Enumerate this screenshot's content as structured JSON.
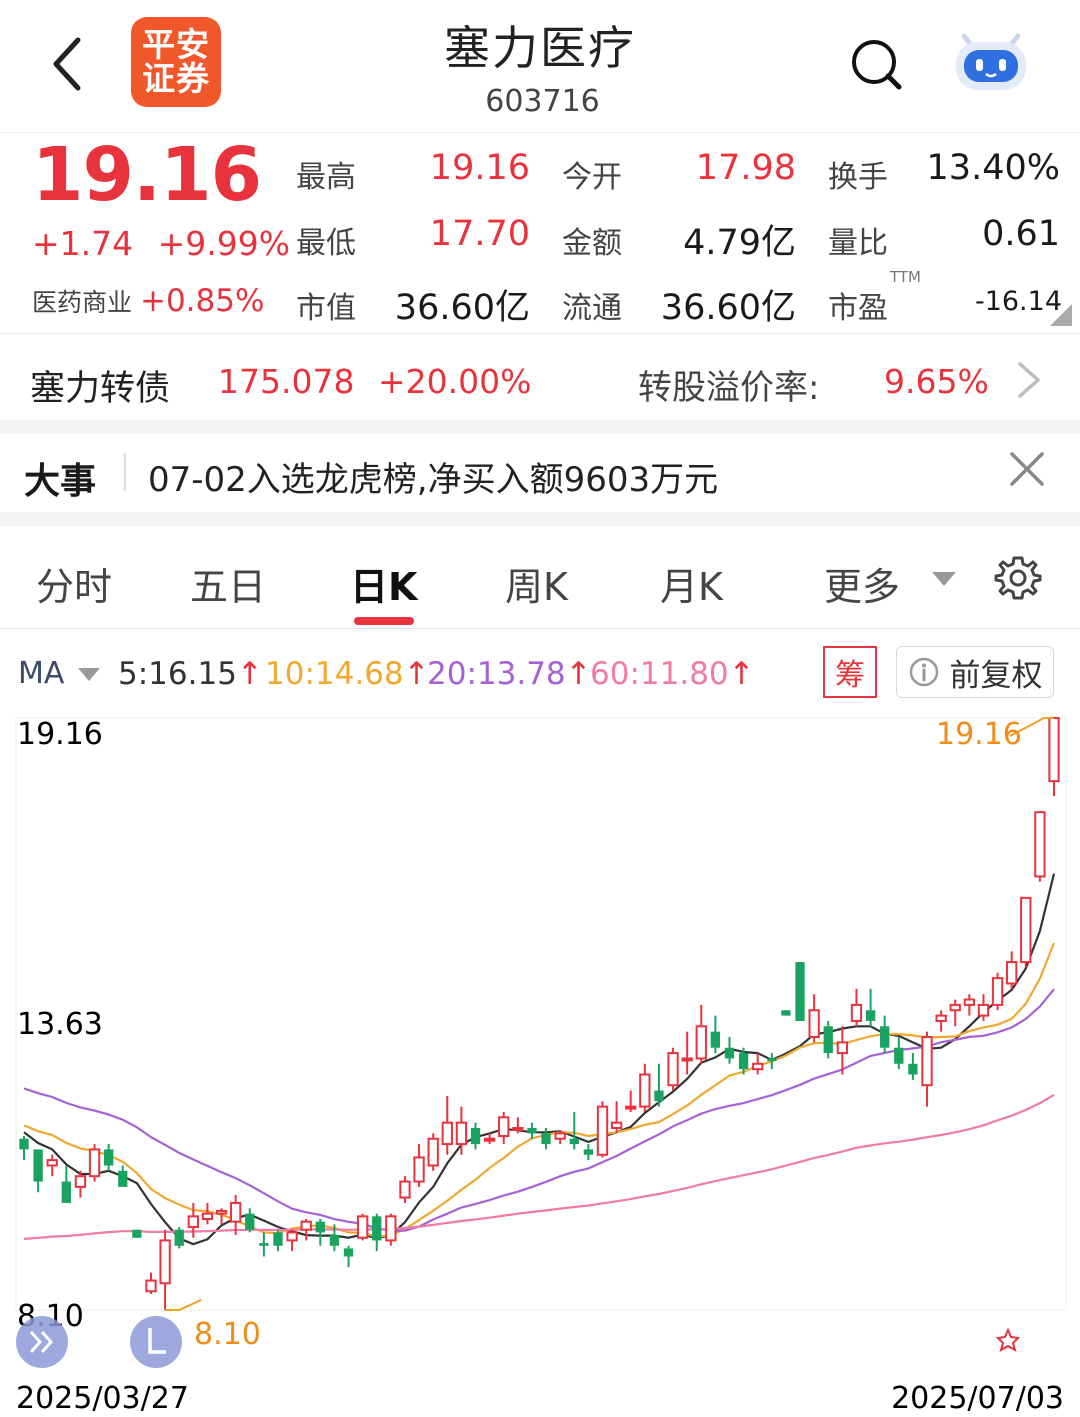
{
  "header": {
    "broker_logo": "平安证券",
    "logo_line1": "平安",
    "logo_line2": "证券",
    "stock_name": "塞力医疗",
    "stock_code": "603716",
    "back_icon": "chevron-left-icon",
    "search_icon": "search-icon",
    "assistant_icon": "robot-icon"
  },
  "quote": {
    "price": "19.16",
    "change": "+1.74",
    "change_pct": "+9.99%",
    "sector_name": "医药商业",
    "sector_pct": "+0.85%",
    "fields": [
      {
        "label": "最高",
        "value": "19.16",
        "color": "#e8333c"
      },
      {
        "label": "今开",
        "value": "17.98",
        "color": "#e8333c"
      },
      {
        "label": "换手",
        "value": "13.40%",
        "color": "#1a1a1a"
      },
      {
        "label": "最低",
        "value": "17.70",
        "color": "#e8333c"
      },
      {
        "label": "金额",
        "value": "4.79亿",
        "color": "#1a1a1a"
      },
      {
        "label": "量比",
        "value": "0.61",
        "color": "#1a1a1a"
      },
      {
        "label": "市值",
        "value": "36.60亿",
        "color": "#1a1a1a"
      },
      {
        "label": "流通",
        "value": "36.60亿",
        "color": "#1a1a1a"
      },
      {
        "label": "市盈",
        "value": "-16.14",
        "color": "#1a1a1a"
      }
    ],
    "pe_superscript": "TTM"
  },
  "bond": {
    "name": "塞力转债",
    "price": "175.078",
    "change_pct": "+20.00%",
    "premium_label": "转股溢价率:",
    "premium_value": "9.65%"
  },
  "event": {
    "tag": "大事",
    "text": "07-02入选龙虎榜,净买入额9603万元"
  },
  "tabs": [
    {
      "label": "分时",
      "active": false
    },
    {
      "label": "五日",
      "active": false
    },
    {
      "label": "日K",
      "active": true
    },
    {
      "label": "周K",
      "active": false
    },
    {
      "label": "月K",
      "active": false
    },
    {
      "label": "更多",
      "active": false
    }
  ],
  "ma": {
    "label": "MA",
    "items": [
      {
        "text": "5:16.15",
        "color": "#333333"
      },
      {
        "text": "10:14.68",
        "color": "#f0a830"
      },
      {
        "text": "20:13.78",
        "color": "#a561d6"
      },
      {
        "text": "60:11.80",
        "color": "#f07aa8"
      }
    ],
    "arrow": "↑",
    "chip_button": "筹",
    "adjust_button": "前复权",
    "info_icon": "info-icon"
  },
  "chart_data": {
    "type": "candlestick",
    "y_max_label": "19.16",
    "y_mid_label": "13.63",
    "y_min_label": "8.10",
    "ylim": [
      8.1,
      19.16
    ],
    "high_marker": "19.16",
    "low_marker": "8.10",
    "start_date": "2025/03/27",
    "end_date": "2025/07/03",
    "colors": {
      "up": "#e8333c",
      "down": "#1aa260",
      "ma5": "#333333",
      "ma10": "#f0a830",
      "ma20": "#a561d6",
      "ma60": "#f07aa8"
    },
    "candles": [
      [
        11.3,
        11.35,
        10.9,
        11.1
      ],
      [
        11.1,
        11.1,
        10.3,
        10.5
      ],
      [
        10.8,
        11.0,
        10.6,
        10.9
      ],
      [
        10.5,
        10.8,
        10.2,
        10.1
      ],
      [
        10.4,
        10.7,
        10.2,
        10.6
      ],
      [
        10.6,
        11.2,
        10.5,
        11.1
      ],
      [
        11.1,
        11.2,
        10.7,
        10.8
      ],
      [
        10.7,
        10.8,
        10.5,
        10.4
      ],
      [
        9.6,
        9.6,
        9.45,
        9.45
      ],
      [
        8.45,
        8.8,
        8.4,
        8.65
      ],
      [
        8.6,
        9.6,
        8.1,
        9.4
      ],
      [
        9.6,
        9.65,
        9.25,
        9.3
      ],
      [
        9.65,
        10.1,
        9.45,
        9.85
      ],
      [
        9.8,
        10.1,
        9.7,
        9.9
      ],
      [
        9.9,
        10.0,
        9.7,
        9.95
      ],
      [
        9.75,
        10.25,
        9.5,
        10.1
      ],
      [
        9.9,
        10.0,
        9.55,
        9.6
      ],
      [
        9.35,
        9.55,
        9.1,
        9.3
      ],
      [
        9.55,
        9.6,
        9.2,
        9.3
      ],
      [
        9.4,
        9.6,
        9.2,
        9.55
      ],
      [
        9.6,
        9.8,
        9.4,
        9.75
      ],
      [
        9.75,
        9.8,
        9.3,
        9.55
      ],
      [
        9.5,
        9.7,
        9.2,
        9.3
      ],
      [
        9.25,
        9.3,
        8.9,
        9.1
      ],
      [
        9.45,
        9.9,
        9.4,
        9.85
      ],
      [
        9.85,
        9.9,
        9.2,
        9.4
      ],
      [
        9.4,
        9.9,
        9.3,
        9.85
      ],
      [
        10.2,
        10.6,
        10.1,
        10.5
      ],
      [
        10.5,
        11.2,
        10.4,
        10.95
      ],
      [
        10.8,
        11.4,
        10.7,
        11.3
      ],
      [
        11.2,
        12.1,
        11.0,
        11.6
      ],
      [
        11.2,
        11.9,
        11.0,
        11.6
      ],
      [
        11.5,
        11.6,
        11.1,
        11.2
      ],
      [
        11.3,
        11.4,
        11.2,
        11.3
      ],
      [
        11.35,
        11.8,
        11.2,
        11.7
      ],
      [
        11.5,
        11.7,
        11.4,
        11.5
      ],
      [
        11.5,
        11.6,
        11.3,
        11.4
      ],
      [
        11.4,
        11.5,
        11.1,
        11.2
      ],
      [
        11.3,
        11.45,
        11.2,
        11.4
      ],
      [
        11.3,
        11.8,
        11.1,
        11.2
      ],
      [
        11.1,
        11.2,
        10.9,
        11.0
      ],
      [
        11.0,
        12.0,
        10.95,
        11.9
      ],
      [
        11.5,
        12.0,
        11.4,
        11.6
      ],
      [
        11.9,
        12.2,
        11.8,
        11.9
      ],
      [
        11.9,
        12.7,
        11.8,
        12.5
      ],
      [
        12.2,
        12.7,
        11.9,
        12.0
      ],
      [
        12.3,
        13.0,
        12.2,
        12.9
      ],
      [
        12.8,
        13.3,
        12.5,
        12.8
      ],
      [
        12.8,
        13.8,
        12.7,
        13.4
      ],
      [
        13.3,
        13.6,
        12.9,
        13.0
      ],
      [
        13.0,
        13.2,
        12.7,
        12.8
      ],
      [
        12.9,
        13.0,
        12.5,
        12.6
      ],
      [
        12.6,
        12.9,
        12.5,
        12.7
      ],
      [
        12.8,
        12.9,
        12.6,
        12.75
      ],
      [
        13.7,
        13.7,
        13.6,
        13.6
      ],
      [
        14.6,
        14.6,
        13.5,
        13.5
      ],
      [
        13.2,
        14.0,
        13.1,
        13.7
      ],
      [
        13.4,
        13.5,
        12.8,
        12.9
      ],
      [
        12.9,
        13.4,
        12.5,
        13.1
      ],
      [
        13.5,
        14.1,
        13.4,
        13.8
      ],
      [
        13.7,
        14.1,
        13.4,
        13.5
      ],
      [
        13.4,
        13.6,
        12.9,
        13.0
      ],
      [
        13.0,
        13.2,
        12.6,
        12.7
      ],
      [
        12.7,
        12.9,
        12.4,
        12.5
      ],
      [
        12.3,
        13.3,
        11.9,
        13.2
      ],
      [
        13.5,
        13.7,
        13.3,
        13.6
      ],
      [
        13.7,
        13.9,
        13.4,
        13.8
      ],
      [
        13.8,
        14.0,
        13.6,
        13.9
      ],
      [
        13.6,
        14.0,
        13.5,
        13.8
      ],
      [
        13.8,
        14.4,
        13.7,
        14.3
      ],
      [
        14.2,
        14.8,
        14.1,
        14.6
      ],
      [
        14.6,
        15.8,
        14.5,
        15.8
      ],
      [
        16.2,
        17.4,
        16.1,
        17.4
      ],
      [
        17.98,
        19.16,
        17.7,
        19.16
      ]
    ]
  }
}
